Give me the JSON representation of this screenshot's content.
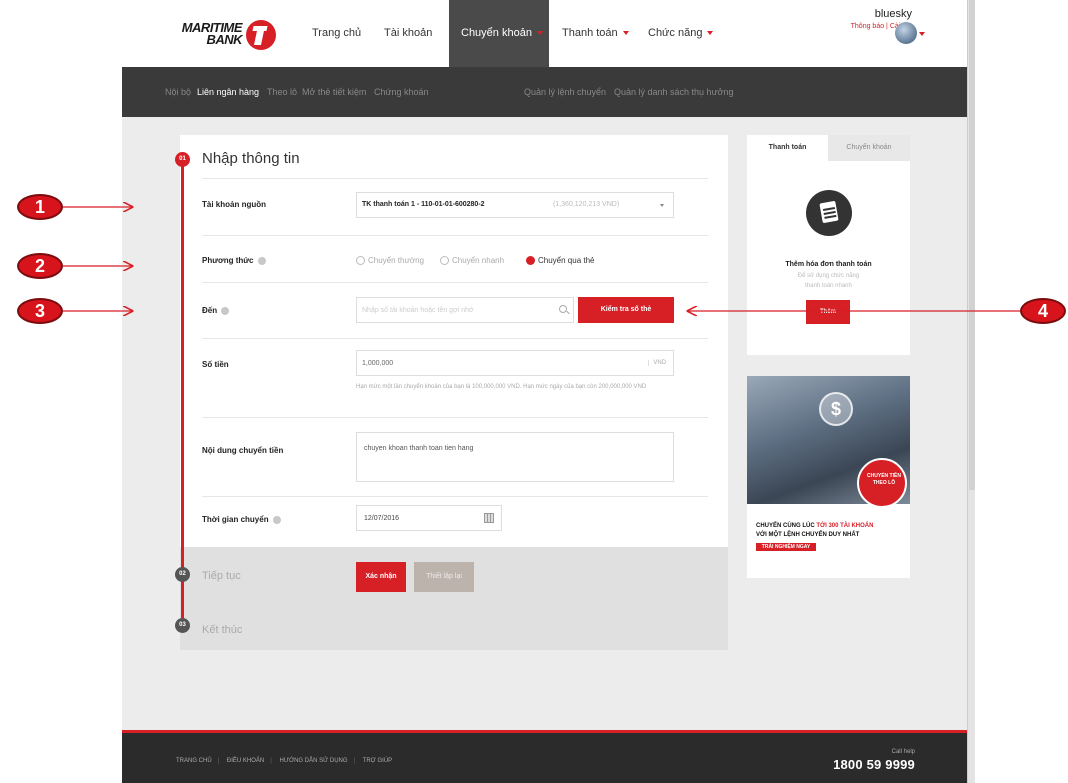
{
  "brand": {
    "logo_line1": "MARITIME",
    "logo_line2": "BANK"
  },
  "nav": [
    {
      "label": "Trang chủ"
    },
    {
      "label": "Tài khoản"
    },
    {
      "label": "Chuyển khoản"
    },
    {
      "label": "Thanh toán"
    },
    {
      "label": "Chức năng"
    }
  ],
  "user": {
    "name": "bluesky",
    "links": "Thông báo | Cài đặt"
  },
  "subnav": [
    {
      "label": "Nội bộ"
    },
    {
      "label": "Liên ngân hàng"
    },
    {
      "label": "Theo lô"
    },
    {
      "label": "Mở thẻ tiết kiệm"
    },
    {
      "label": "Chứng khoán"
    },
    {
      "label": "Quản lý lệnh chuyển"
    },
    {
      "label": "Quản lý danh sách thụ hưởng"
    }
  ],
  "steps": [
    {
      "num": "01",
      "title": "Nhập thông tin"
    },
    {
      "num": "02",
      "title": "Tiếp tục"
    },
    {
      "num": "03",
      "title": "Kết thúc"
    }
  ],
  "form": {
    "source_label": "Tài khoản nguồn",
    "source_value": "TK thanh toán 1 - 110-01-01-600280-2",
    "source_balance": "(1,360,120,213 VND)",
    "method_label": "Phương thức",
    "methods": [
      "Chuyển thường",
      "Chuyển nhanh",
      "Chuyển qua thẻ"
    ],
    "to_label": "Đến",
    "to_placeholder": "Nhập số tài khoản hoặc tên gợi nhớ",
    "check_button": "Kiểm tra số thẻ",
    "amount_label": "Số tiền",
    "amount_value": "1,000,000",
    "amount_unit": "VND",
    "limit_note": "Hạn mức một lần chuyển khoản của bạn là 100,000,000 VND. Hạn mức ngày của bạn còn 200,000,000 VND",
    "content_label": "Nội dung chuyển tiền",
    "content_value": "chuyen khoan thanh toan tien hang",
    "time_label": "Thời gian chuyển",
    "time_value": "12/07/2016",
    "confirm_button": "Xác nhận",
    "reset_button": "Thiết lập lại"
  },
  "sidebar": {
    "tab_payment": "Thanh toán",
    "tab_transfer": "Chuyển khoản",
    "title": "Thêm hóa đơn thanh toán",
    "subtitle1": "Để sử dụng chức năng",
    "subtitle2": "thanh toán nhanh",
    "add_button": "Thêm"
  },
  "banner": {
    "ring_text": "CHUYỂN TIỀN THEO LÔ",
    "line1_a": "CHUYỂN CÙNG LÚC ",
    "line1_b": "TỚI 300 TÀI KHOẢN",
    "line2": "VỚI MỘT LỆNH CHUYỂN DUY NHẤT",
    "cta": "TRẢI NGHIỆM NGAY"
  },
  "footer": {
    "links": [
      "TRANG CHỦ",
      "ĐIỀU KHOẢN",
      "HƯỚNG DẪN SỬ DỤNG",
      "TRỢ GIÚP"
    ],
    "hotline_label": "Call help",
    "hotline": "1800 59 9999"
  },
  "annotations": [
    "1",
    "2",
    "3",
    "4"
  ],
  "colors": {
    "brand_red": "#d71f26",
    "nav_active": "#4a4a4a",
    "subnav_bg": "#3a3a3a"
  }
}
